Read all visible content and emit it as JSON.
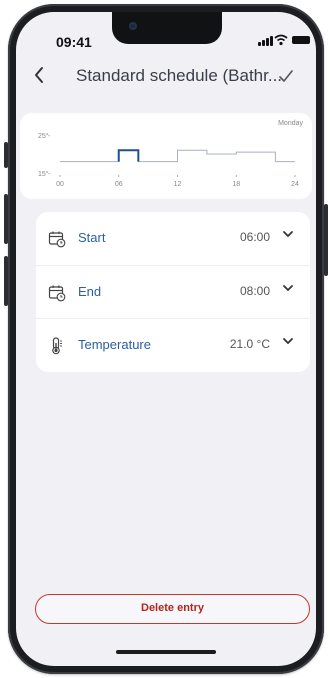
{
  "status_bar": {
    "time": "09:41"
  },
  "header": {
    "title": "Standard schedule (Bathr...",
    "back_icon": "chevron-left-icon",
    "confirm_icon": "checkmark-icon"
  },
  "chart_data": {
    "type": "line",
    "title": "Monday",
    "x_ticks": [
      "00",
      "06",
      "12",
      "18",
      "24"
    ],
    "y_ticks": [
      "25°",
      "15°"
    ],
    "xlim": [
      0,
      24
    ],
    "ylim": [
      15,
      25
    ],
    "series": [
      {
        "x": [
          0,
          6,
          6,
          8,
          8,
          12,
          12,
          15,
          15,
          18,
          18,
          22,
          22,
          24
        ],
        "y": [
          18,
          18,
          21,
          21,
          18,
          18,
          21,
          21,
          20,
          20,
          20.5,
          20.5,
          18,
          18
        ],
        "color": "#a9b0c2"
      }
    ],
    "highlight": {
      "x_start": 6,
      "x_end": 8,
      "value": 21,
      "color": "#1f4e99"
    }
  },
  "settings": {
    "start": {
      "label": "Start",
      "value": "06:00",
      "icon": "calendar-clock-icon"
    },
    "end": {
      "label": "End",
      "value": "08:00",
      "icon": "calendar-clock-icon"
    },
    "temperature": {
      "label": "Temperature",
      "value": "21.0 °C",
      "icon": "thermometer-icon"
    }
  },
  "actions": {
    "delete_label": "Delete entry"
  }
}
